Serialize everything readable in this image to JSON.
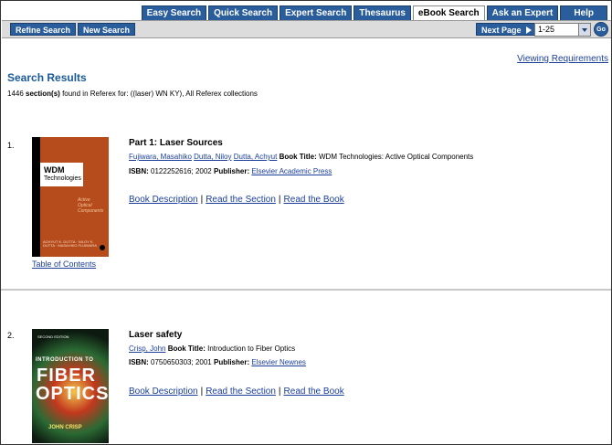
{
  "tabs": [
    "Easy Search",
    "Quick Search",
    "Expert Search",
    "Thesaurus",
    "eBook Search",
    "Ask an Expert",
    "Help"
  ],
  "active_tab": "eBook Search",
  "toolbar": {
    "refine_label": "Refine Search",
    "new_label": "New Search",
    "next_label": "Next Page",
    "range_value": "1-25",
    "go_label": "Go"
  },
  "viewing_requirements": "Viewing Requirements",
  "results_title": "Search Results",
  "found": {
    "count_prefix": "1446",
    "bold_label": "section(s)",
    "suffix": "found in Referex for: ((laser) WN KY), All Referex collections"
  },
  "labels": {
    "book_title": "Book Title:",
    "isbn": "ISBN:",
    "publisher": "Publisher:",
    "book_description": "Book Description",
    "read_section": "Read the Section",
    "read_book": "Read the Book",
    "table_of_contents": "Table of Contents",
    "sep": "|"
  },
  "results": [
    {
      "number": "1.",
      "title": "Part 1: Laser Sources",
      "authors": [
        "Fujiwara, Masahiko",
        "Dutta, Niloy",
        "Dutta, Achyut"
      ],
      "book_title": "WDM Technologies: Active Optical Components",
      "isbn": "0122252616; 2002",
      "publisher": "Elsevier Academic Press",
      "cover": {
        "title_line1": "WDM",
        "title_line2": "Technologies",
        "subtitle": "Active Optical Components",
        "authors": "ACHYUT K. DUTTA · NILOY K. DUTTA · MASAHIKO FUJIWARA"
      }
    },
    {
      "number": "2.",
      "title": "Laser safety",
      "authors": [
        "Crisp, John"
      ],
      "book_title": "Introduction to Fiber Optics",
      "isbn": "0750650303; 2001",
      "publisher": "Elsevier Newnes",
      "cover": {
        "edition": "SECOND EDITION",
        "line1": "INTRODUCTION TO",
        "line2": "FIBER",
        "line3": "OPTICS",
        "author": "JOHN CRISP"
      }
    }
  ],
  "colors": {
    "tab_blue": "#2a5d9b",
    "heading_blue": "#1a5a9a",
    "link_blue": "#1a3e9a",
    "cover1_orange": "#b64b1c"
  }
}
